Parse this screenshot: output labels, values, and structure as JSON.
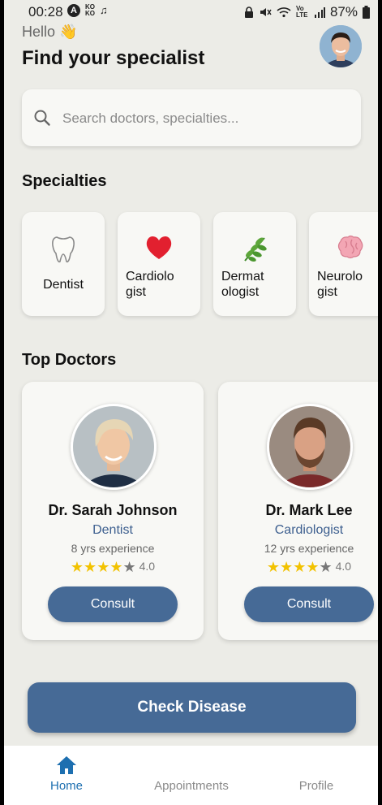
{
  "status_bar": {
    "time": "00:28",
    "battery": "87%"
  },
  "header": {
    "greeting": "Hello 👋",
    "title": "Find your specialist"
  },
  "search": {
    "placeholder": "Search doctors, specialties..."
  },
  "specialties": {
    "title": "Specialties",
    "items": [
      {
        "label": "Dentist",
        "icon": "tooth-icon"
      },
      {
        "label": "Cardiolo\ngist",
        "icon": "heart-icon"
      },
      {
        "label": "Dermat\nologist",
        "icon": "leaf-icon"
      },
      {
        "label": "Neurolo\ngist",
        "icon": "brain-icon"
      }
    ]
  },
  "top_doctors": {
    "title": "Top Doctors",
    "items": [
      {
        "name": "Dr. Sarah Johnson",
        "specialty": "Dentist",
        "experience": "8 yrs experience",
        "rating": "4.0",
        "stars": 4,
        "button": "Consult"
      },
      {
        "name": "Dr. Mark Lee",
        "specialty": "Cardiologist",
        "experience": "12 yrs experience",
        "rating": "4.0",
        "stars": 4,
        "button": "Consult"
      }
    ]
  },
  "check_disease": {
    "label": "Check Disease"
  },
  "bottom_nav": {
    "items": [
      {
        "label": "Home",
        "active": true
      },
      {
        "label": "Appointments",
        "active": false
      },
      {
        "label": "Profile",
        "active": false
      }
    ]
  },
  "colors": {
    "primary": "#466a96",
    "background": "#ecece7",
    "card": "#f8f8f5",
    "star": "#f2c200",
    "nav_active": "#1d6fb0"
  }
}
